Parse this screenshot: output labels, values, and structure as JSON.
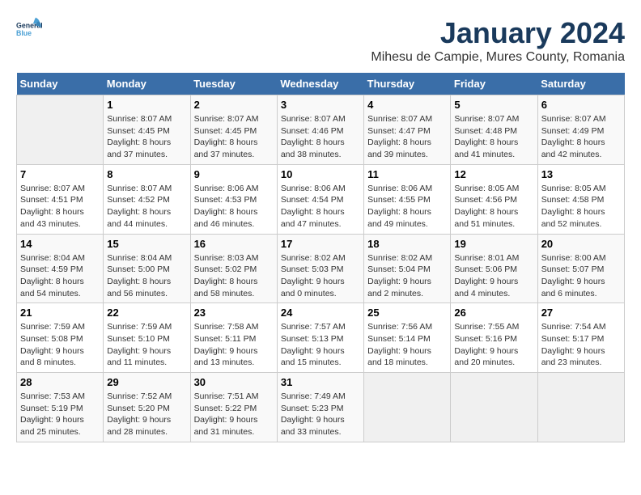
{
  "logo": {
    "line1": "General",
    "line2": "Blue"
  },
  "title": "January 2024",
  "subtitle": "Mihesu de Campie, Mures County, Romania",
  "days_of_week": [
    "Sunday",
    "Monday",
    "Tuesday",
    "Wednesday",
    "Thursday",
    "Friday",
    "Saturday"
  ],
  "weeks": [
    [
      {
        "day": "",
        "info": ""
      },
      {
        "day": "1",
        "info": "Sunrise: 8:07 AM\nSunset: 4:45 PM\nDaylight: 8 hours\nand 37 minutes."
      },
      {
        "day": "2",
        "info": "Sunrise: 8:07 AM\nSunset: 4:45 PM\nDaylight: 8 hours\nand 37 minutes."
      },
      {
        "day": "3",
        "info": "Sunrise: 8:07 AM\nSunset: 4:46 PM\nDaylight: 8 hours\nand 38 minutes."
      },
      {
        "day": "4",
        "info": "Sunrise: 8:07 AM\nSunset: 4:47 PM\nDaylight: 8 hours\nand 39 minutes."
      },
      {
        "day": "5",
        "info": "Sunrise: 8:07 AM\nSunset: 4:48 PM\nDaylight: 8 hours\nand 41 minutes."
      },
      {
        "day": "6",
        "info": "Sunrise: 8:07 AM\nSunset: 4:49 PM\nDaylight: 8 hours\nand 42 minutes."
      }
    ],
    [
      {
        "day": "7",
        "info": "Sunrise: 8:07 AM\nSunset: 4:51 PM\nDaylight: 8 hours\nand 43 minutes."
      },
      {
        "day": "8",
        "info": "Sunrise: 8:07 AM\nSunset: 4:52 PM\nDaylight: 8 hours\nand 44 minutes."
      },
      {
        "day": "9",
        "info": "Sunrise: 8:06 AM\nSunset: 4:53 PM\nDaylight: 8 hours\nand 46 minutes."
      },
      {
        "day": "10",
        "info": "Sunrise: 8:06 AM\nSunset: 4:54 PM\nDaylight: 8 hours\nand 47 minutes."
      },
      {
        "day": "11",
        "info": "Sunrise: 8:06 AM\nSunset: 4:55 PM\nDaylight: 8 hours\nand 49 minutes."
      },
      {
        "day": "12",
        "info": "Sunrise: 8:05 AM\nSunset: 4:56 PM\nDaylight: 8 hours\nand 51 minutes."
      },
      {
        "day": "13",
        "info": "Sunrise: 8:05 AM\nSunset: 4:58 PM\nDaylight: 8 hours\nand 52 minutes."
      }
    ],
    [
      {
        "day": "14",
        "info": "Sunrise: 8:04 AM\nSunset: 4:59 PM\nDaylight: 8 hours\nand 54 minutes."
      },
      {
        "day": "15",
        "info": "Sunrise: 8:04 AM\nSunset: 5:00 PM\nDaylight: 8 hours\nand 56 minutes."
      },
      {
        "day": "16",
        "info": "Sunrise: 8:03 AM\nSunset: 5:02 PM\nDaylight: 8 hours\nand 58 minutes."
      },
      {
        "day": "17",
        "info": "Sunrise: 8:02 AM\nSunset: 5:03 PM\nDaylight: 9 hours\nand 0 minutes."
      },
      {
        "day": "18",
        "info": "Sunrise: 8:02 AM\nSunset: 5:04 PM\nDaylight: 9 hours\nand 2 minutes."
      },
      {
        "day": "19",
        "info": "Sunrise: 8:01 AM\nSunset: 5:06 PM\nDaylight: 9 hours\nand 4 minutes."
      },
      {
        "day": "20",
        "info": "Sunrise: 8:00 AM\nSunset: 5:07 PM\nDaylight: 9 hours\nand 6 minutes."
      }
    ],
    [
      {
        "day": "21",
        "info": "Sunrise: 7:59 AM\nSunset: 5:08 PM\nDaylight: 9 hours\nand 8 minutes."
      },
      {
        "day": "22",
        "info": "Sunrise: 7:59 AM\nSunset: 5:10 PM\nDaylight: 9 hours\nand 11 minutes."
      },
      {
        "day": "23",
        "info": "Sunrise: 7:58 AM\nSunset: 5:11 PM\nDaylight: 9 hours\nand 13 minutes."
      },
      {
        "day": "24",
        "info": "Sunrise: 7:57 AM\nSunset: 5:13 PM\nDaylight: 9 hours\nand 15 minutes."
      },
      {
        "day": "25",
        "info": "Sunrise: 7:56 AM\nSunset: 5:14 PM\nDaylight: 9 hours\nand 18 minutes."
      },
      {
        "day": "26",
        "info": "Sunrise: 7:55 AM\nSunset: 5:16 PM\nDaylight: 9 hours\nand 20 minutes."
      },
      {
        "day": "27",
        "info": "Sunrise: 7:54 AM\nSunset: 5:17 PM\nDaylight: 9 hours\nand 23 minutes."
      }
    ],
    [
      {
        "day": "28",
        "info": "Sunrise: 7:53 AM\nSunset: 5:19 PM\nDaylight: 9 hours\nand 25 minutes."
      },
      {
        "day": "29",
        "info": "Sunrise: 7:52 AM\nSunset: 5:20 PM\nDaylight: 9 hours\nand 28 minutes."
      },
      {
        "day": "30",
        "info": "Sunrise: 7:51 AM\nSunset: 5:22 PM\nDaylight: 9 hours\nand 31 minutes."
      },
      {
        "day": "31",
        "info": "Sunrise: 7:49 AM\nSunset: 5:23 PM\nDaylight: 9 hours\nand 33 minutes."
      },
      {
        "day": "",
        "info": ""
      },
      {
        "day": "",
        "info": ""
      },
      {
        "day": "",
        "info": ""
      }
    ]
  ]
}
